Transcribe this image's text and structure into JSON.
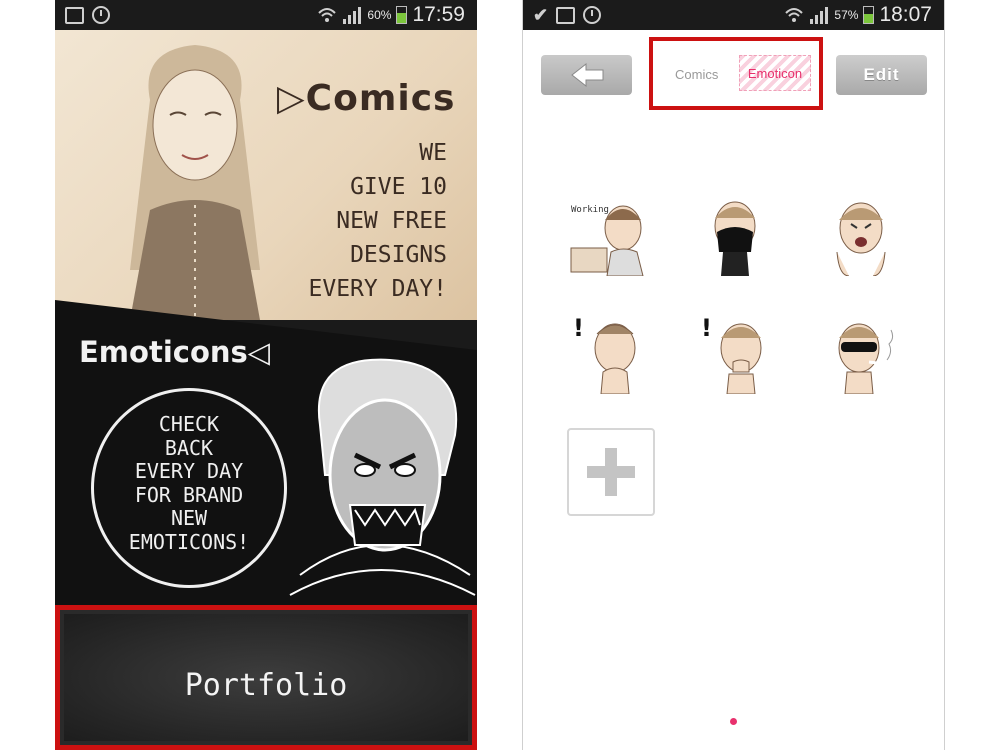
{
  "left_screen": {
    "status_bar": {
      "battery": "60%",
      "battery_level": 0.6,
      "time": "17:59"
    },
    "comics": {
      "title": "▷Comics",
      "lines": [
        "WE",
        "GIVE 10",
        "NEW FREE",
        "DESIGNS",
        "EVERY DAY!"
      ]
    },
    "emoticons": {
      "title": "Emoticons◁",
      "bubble_lines": [
        "CHECK",
        "BACK",
        "EVERY DAY",
        "FOR BRAND",
        "NEW",
        "EMOTICONS!"
      ]
    },
    "portfolio_label": "Portfolio"
  },
  "right_screen": {
    "status_bar": {
      "battery": "57%",
      "battery_level": 0.57,
      "time": "18:07"
    },
    "header": {
      "tab_comics": "Comics",
      "tab_emoticon": "Emoticon",
      "edit_label": "Edit"
    },
    "stickers": [
      {
        "icon": "working-sticker",
        "caption": "Working"
      },
      {
        "icon": "masked-face-sticker"
      },
      {
        "icon": "crying-face-sticker"
      },
      {
        "icon": "surprised-sticker"
      },
      {
        "icon": "shocked-hand-sticker"
      },
      {
        "icon": "sunglasses-smoking-sticker"
      }
    ],
    "add_button_icon": "plus-icon"
  },
  "colors": {
    "highlight": "#cc1111",
    "accent_pink": "#e8316d"
  }
}
